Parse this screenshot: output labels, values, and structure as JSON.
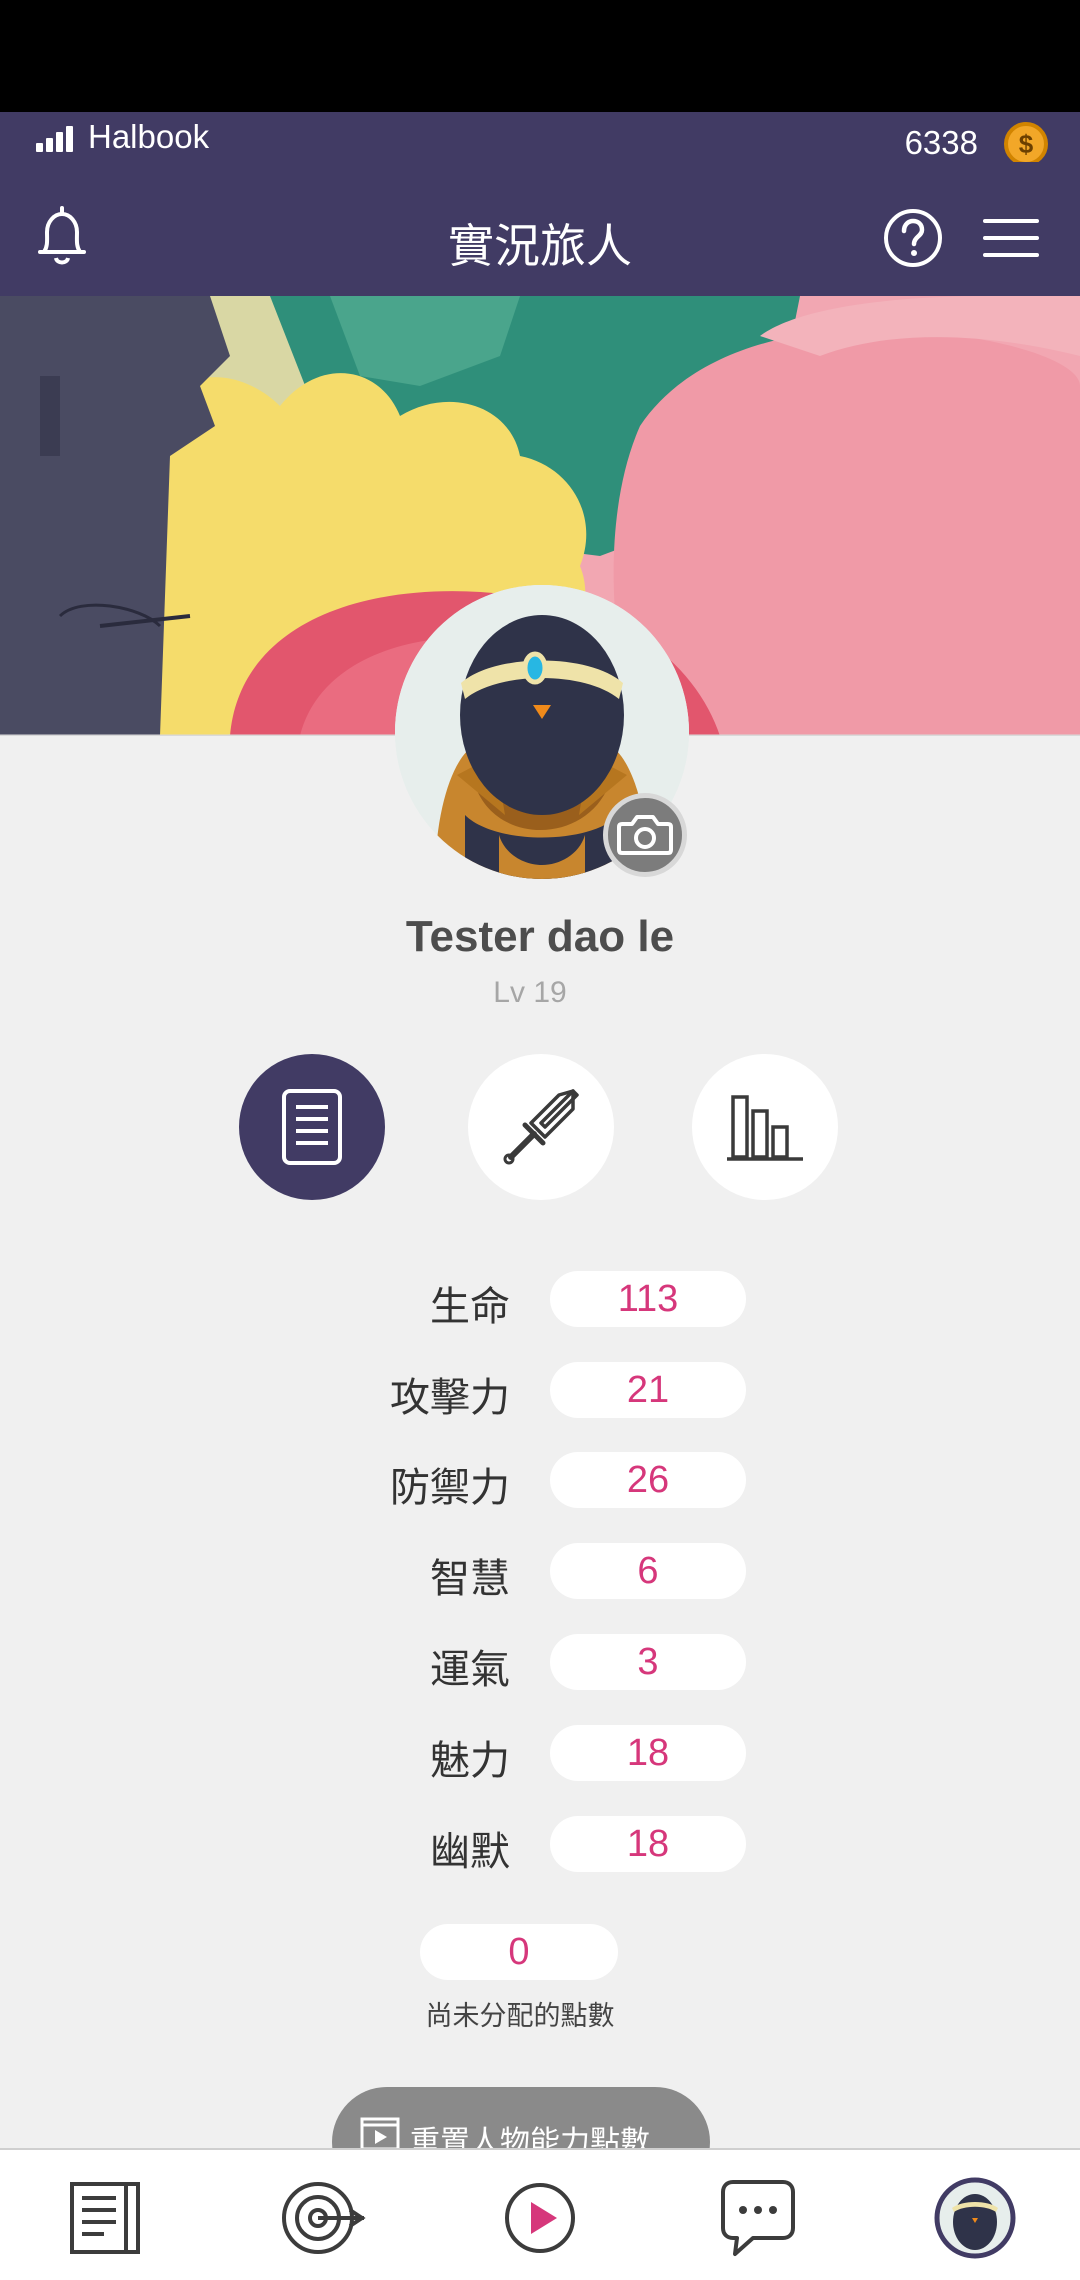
{
  "status_bar": {
    "carrier": "Halbook",
    "coins": "6338",
    "coin_symbol": "$"
  },
  "app_bar": {
    "title": "實況旅人"
  },
  "profile": {
    "name": "Tester dao le",
    "level": "Lv 19"
  },
  "tabs": [
    {
      "name": "stats-tab",
      "icon": "document-icon",
      "active": true
    },
    {
      "name": "equipment-tab",
      "icon": "sword-icon",
      "active": false
    },
    {
      "name": "ranking-tab",
      "icon": "bar-chart-icon",
      "active": false
    }
  ],
  "stats": [
    {
      "label": "生命",
      "value": "113"
    },
    {
      "label": "攻擊力",
      "value": "21"
    },
    {
      "label": "防禦力",
      "value": "26"
    },
    {
      "label": "智慧",
      "value": "6"
    },
    {
      "label": "運氣",
      "value": "3"
    },
    {
      "label": "魅力",
      "value": "18"
    },
    {
      "label": "幽默",
      "value": "18"
    }
  ],
  "unassigned": {
    "value": "0",
    "label": "尚未分配的點數"
  },
  "reset_button": {
    "label": "重置人物能力點數"
  },
  "bottom_nav": [
    "journal-icon",
    "target-icon",
    "play-icon",
    "chat-icon",
    "avatar-icon"
  ],
  "colors": {
    "primary": "#413b64",
    "accent_pink": "#d6377b",
    "coin": "#f2a728",
    "background": "#f0f0f0"
  }
}
